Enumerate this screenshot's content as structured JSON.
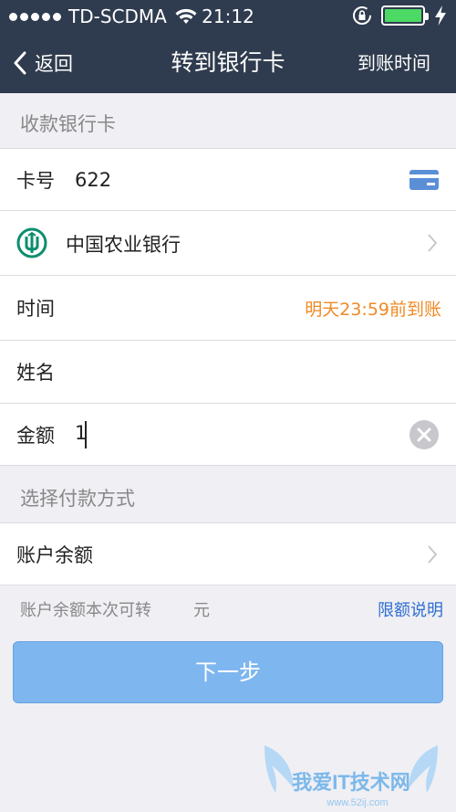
{
  "status_bar": {
    "carrier": "TD-SCDMA",
    "time": "21:12",
    "battery_level": 1.0,
    "battery_color": "#4cd964"
  },
  "nav": {
    "back_label": "返回",
    "title": "转到银行卡",
    "right_label": "到账时间"
  },
  "receiver_section": {
    "title": "收款银行卡"
  },
  "card_row": {
    "label": "卡号",
    "value": "622",
    "icon": "card-icon"
  },
  "bank_row": {
    "name": "中国农业银行",
    "logo": "abc-bank-logo"
  },
  "time_row": {
    "label": "时间",
    "value": "明天23:59前到账",
    "value_color": "#f08a24"
  },
  "name_row": {
    "label": "姓名"
  },
  "amount_row": {
    "label": "金额",
    "value": "1"
  },
  "payment_section": {
    "title": "选择付款方式"
  },
  "method_row": {
    "label": "账户余额"
  },
  "balance_note": {
    "text": "账户余额本次可转",
    "unit": "元",
    "link": "限额说明"
  },
  "next_button": {
    "label": "下一步"
  },
  "watermark": {
    "text": "我爱IT技术网",
    "url": "www.52ij.com"
  }
}
